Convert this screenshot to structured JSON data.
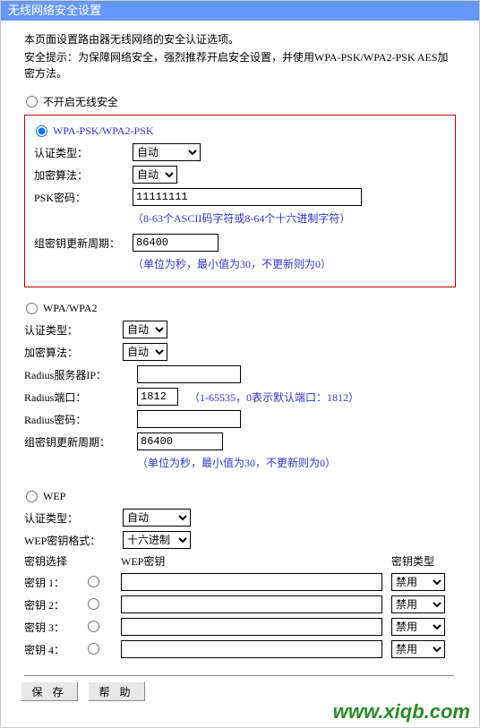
{
  "window_title": "无线网络安全设置",
  "intro_line": "本页面设置路由器无线网络的安全认证选项。",
  "intro_warn": "安全提示：为保障网络安全，强烈推荐开启安全设置，并使用WPA-PSK/WPA2-PSK AES加密方法。",
  "disable_label": "不开启无线安全",
  "wpa_psk": {
    "title": "WPA-PSK/WPA2-PSK",
    "auth_label": "认证类型：",
    "auth_value": "自动",
    "enc_label": "加密算法：",
    "enc_value": "自动",
    "psk_label": "PSK密码：",
    "psk_value": "11111111",
    "psk_hint": "（8-63个ASCII码字符或8-64个十六进制字符）",
    "rekey_label": "组密钥更新周期：",
    "rekey_value": "86400",
    "rekey_hint": "（单位为秒，最小值为30，不更新则为0）"
  },
  "wpa": {
    "title": "WPA/WPA2",
    "auth_label": "认证类型：",
    "auth_value": "自动",
    "enc_label": "加密算法：",
    "enc_value": "自动",
    "radius_ip_label": "Radius服务器IP：",
    "radius_ip_value": "",
    "radius_port_label": "Radius端口：",
    "radius_port_value": "1812",
    "radius_port_hint": "（1-65535，0表示默认端口：1812）",
    "radius_pwd_label": "Radius密码：",
    "radius_pwd_value": "",
    "rekey_label": "组密钥更新周期：",
    "rekey_value": "86400",
    "rekey_hint": "（单位为秒，最小值为30，不更新则为0）"
  },
  "wep": {
    "title": "WEP",
    "auth_label": "认证类型：",
    "auth_value": "自动",
    "fmt_label": "WEP密钥格式：",
    "fmt_value": "十六进制",
    "col_select": "密钥选择",
    "col_key": "WEP密钥",
    "col_type": "密钥类型",
    "rows": [
      {
        "label": "密钥 1：",
        "key": "",
        "type": "禁用"
      },
      {
        "label": "密钥 2：",
        "key": "",
        "type": "禁用"
      },
      {
        "label": "密钥 3：",
        "key": "",
        "type": "禁用"
      },
      {
        "label": "密钥 4：",
        "key": "",
        "type": "禁用"
      }
    ]
  },
  "buttons": {
    "save": "保 存",
    "help": "帮 助"
  },
  "watermark": "www.xiqb.com"
}
